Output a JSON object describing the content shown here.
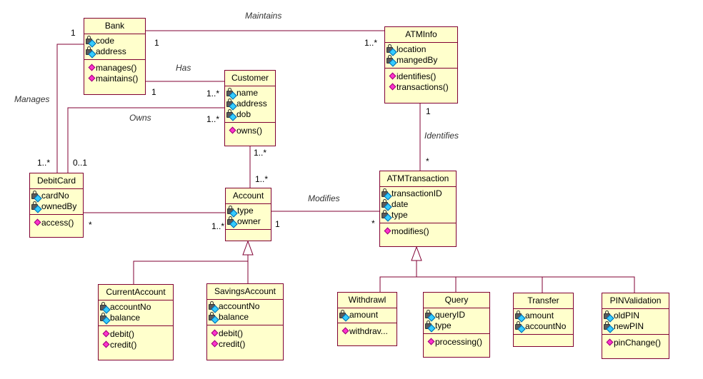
{
  "diagram": {
    "colors": {
      "line": "#800033",
      "fill": "#ffffcc",
      "attr_icon": "#33ccff",
      "op_icon": "#ff33cc"
    },
    "classes": {
      "bank": {
        "name": "Bank",
        "attributes": [
          "code",
          "address"
        ],
        "operations": [
          "manages()",
          "maintains()"
        ]
      },
      "atminfo": {
        "name": "ATMInfo",
        "attributes": [
          "location",
          "mangedBy"
        ],
        "operations": [
          "identifies()",
          "transactions()"
        ]
      },
      "customer": {
        "name": "Customer",
        "attributes": [
          "name",
          "address",
          "dob"
        ],
        "operations": [
          "owns()"
        ]
      },
      "debitcard": {
        "name": "DebitCard",
        "attributes": [
          "cardNo",
          "ownedBy"
        ],
        "operations": [
          "access()"
        ]
      },
      "account": {
        "name": "Account",
        "attributes": [
          "type",
          "owner"
        ],
        "operations": []
      },
      "atmtransaction": {
        "name": "ATMTransaction",
        "attributes": [
          "transactionID",
          "date",
          "type"
        ],
        "operations": [
          "modifies()"
        ]
      },
      "currentaccount": {
        "name": "CurrentAccount",
        "attributes": [
          "accountNo",
          "balance"
        ],
        "operations": [
          "debit()",
          "credit()"
        ]
      },
      "savingsaccount": {
        "name": "SavingsAccount",
        "attributes": [
          "accountNo",
          "balance"
        ],
        "operations": [
          "debit()",
          "credit()"
        ]
      },
      "withdrawl": {
        "name": "Withdrawl",
        "attributes": [
          "amount"
        ],
        "operations": [
          "withdrav..."
        ]
      },
      "query": {
        "name": "Query",
        "attributes": [
          "queryID",
          "type"
        ],
        "operations": [
          "processing()"
        ]
      },
      "transfer": {
        "name": "Transfer",
        "attributes": [
          "amount",
          "accountNo"
        ],
        "operations": []
      },
      "pinvalidation": {
        "name": "PINValidation",
        "attributes": [
          "oldPIN",
          "newPIN"
        ],
        "operations": [
          "pinChange()"
        ]
      }
    },
    "associations": {
      "maintains": {
        "name": "Maintains",
        "from_mult": "1",
        "to_mult": "1..*"
      },
      "has": {
        "name": "Has",
        "from_mult": "1",
        "to_mult": "1..*"
      },
      "manages": {
        "name": "Manages",
        "from_mult": "1",
        "to_mult": "1..*"
      },
      "owns": {
        "name": "Owns",
        "from_mult": "1..*",
        "to_mult": "0..1"
      },
      "customer_account": {
        "from_mult": "1..*",
        "to_mult": "1..*"
      },
      "debitcard_account": {
        "from_mult": "*",
        "to_mult": "1..*"
      },
      "identifies": {
        "name": "Identifies",
        "from_mult": "1",
        "to_mult": "*"
      },
      "modifies": {
        "name": "Modifies",
        "from_mult": "1",
        "to_mult": "*"
      }
    }
  }
}
